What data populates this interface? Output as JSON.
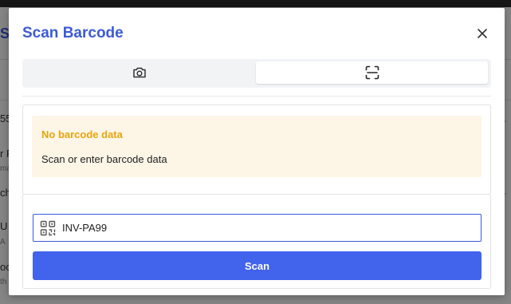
{
  "modal": {
    "title": "Scan Barcode",
    "close_icon": "close-icon",
    "tabs": [
      {
        "icon": "camera-icon",
        "active": false
      },
      {
        "icon": "scan-icon",
        "active": true
      }
    ],
    "result": {
      "status_title": "No barcode data",
      "status_message": "Scan or enter barcode data"
    },
    "entry": {
      "icon": "qr-code-icon",
      "value": "INV-PA99",
      "scan_label": "Scan"
    }
  },
  "colors": {
    "accent": "#4263eb",
    "title": "#3b5bd6",
    "warning_text": "#e8a40e",
    "warning_bg": "#fdf6e7"
  }
}
